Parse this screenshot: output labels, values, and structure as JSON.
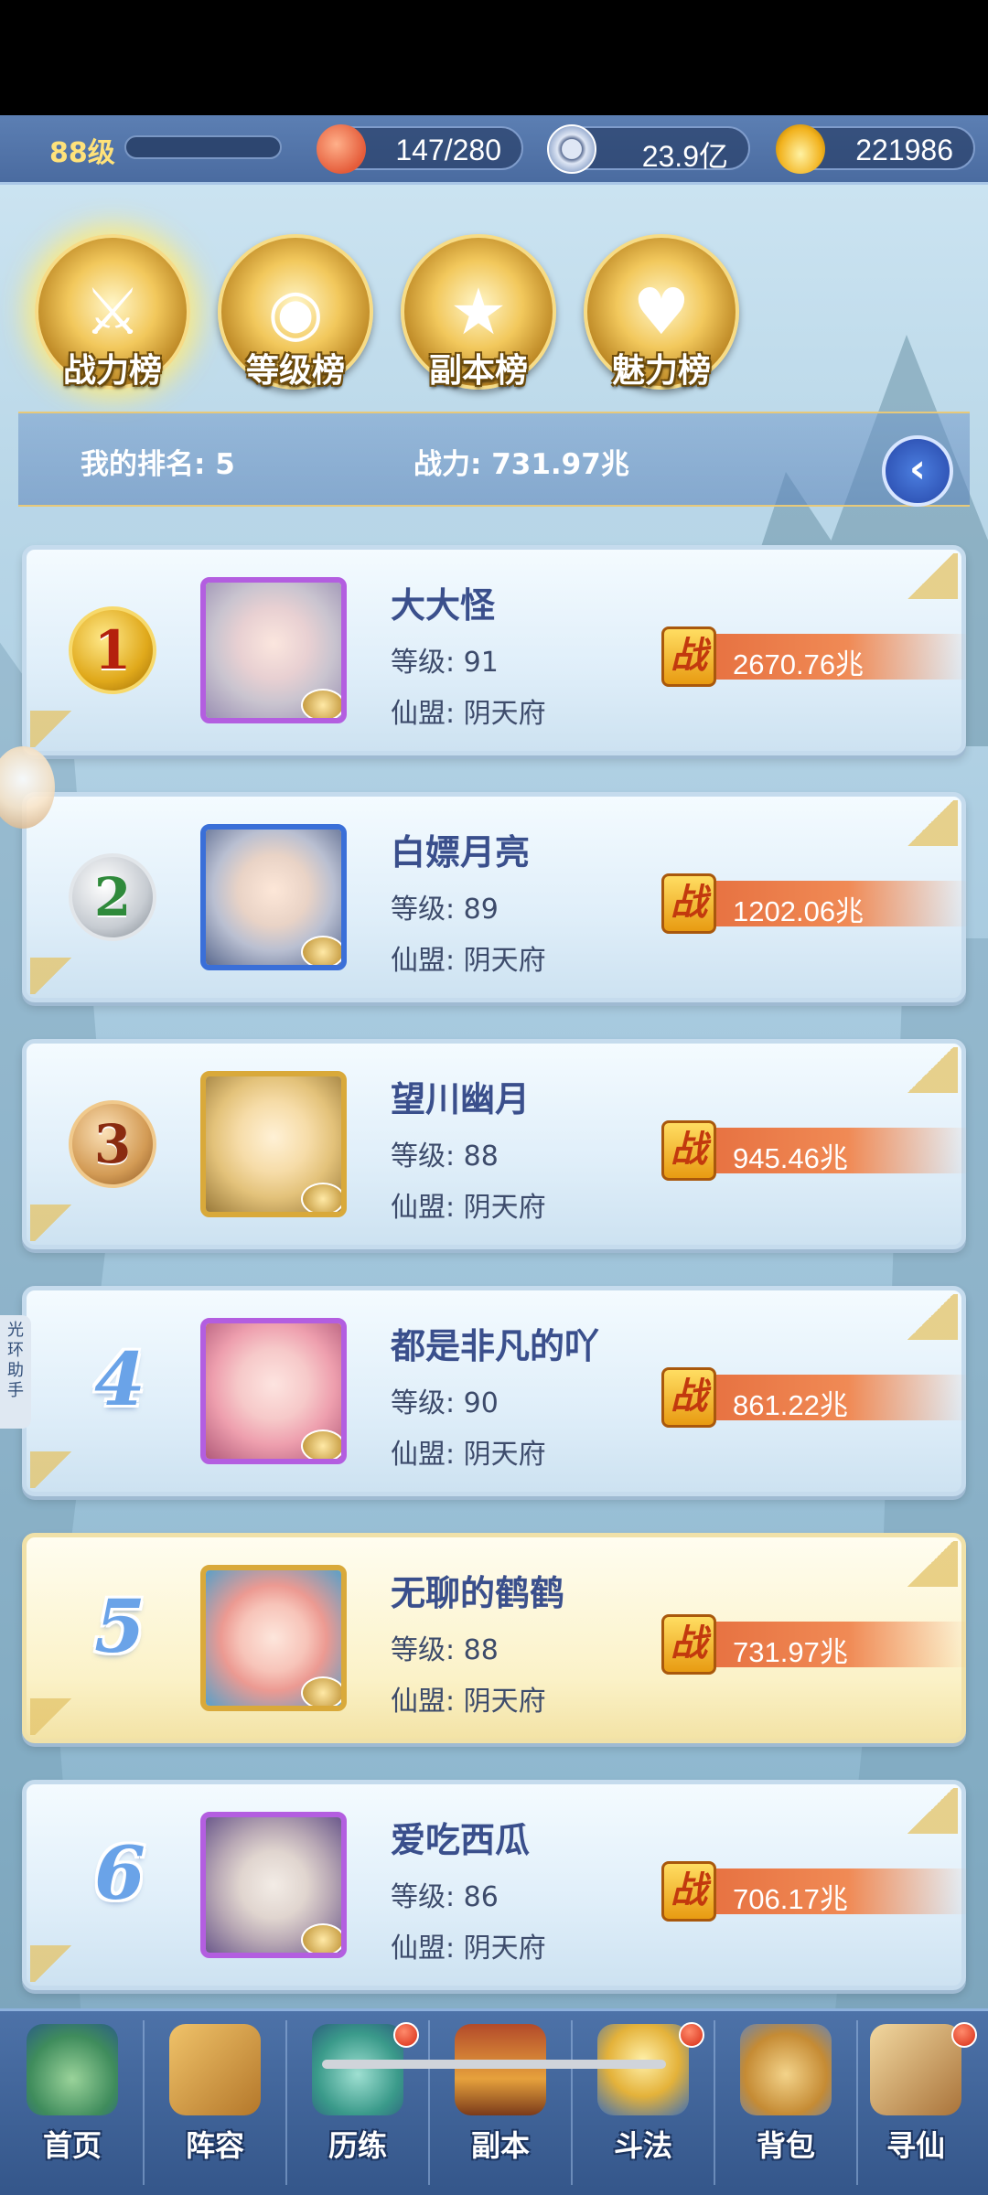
{
  "status": {
    "level": "88级",
    "stamina": "147/280",
    "silver": "23.9亿",
    "gold": "221986",
    "icons": [
      "peach-icon",
      "coin-icon",
      "gold-ingot-icon"
    ]
  },
  "tabs": [
    {
      "label": "战力榜",
      "icon": "sword-emblem-icon",
      "active": true
    },
    {
      "label": "等级榜",
      "icon": "drum-emblem-icon",
      "active": false
    },
    {
      "label": "副本榜",
      "icon": "star-emblem-icon",
      "active": false
    },
    {
      "label": "魅力榜",
      "icon": "heart-emblem-icon",
      "active": false
    }
  ],
  "my_rank": {
    "rank_text": "我的排名: 5",
    "power_text": "战力: 731.97兆"
  },
  "power_badge": "战",
  "rankings": [
    {
      "rank": "1",
      "name": "大大怪",
      "level": "等级: 91",
      "guild": "仙盟: 阴天府",
      "power": "2670.76兆"
    },
    {
      "rank": "2",
      "name": "白嫖月亮",
      "level": "等级: 89",
      "guild": "仙盟: 阴天府",
      "power": "1202.06兆"
    },
    {
      "rank": "3",
      "name": "望川幽月",
      "level": "等级: 88",
      "guild": "仙盟: 阴天府",
      "power": "945.46兆"
    },
    {
      "rank": "4",
      "name": "都是非凡的吖",
      "level": "等级: 90",
      "guild": "仙盟: 阴天府",
      "power": "861.22兆"
    },
    {
      "rank": "5",
      "name": "无聊的鹤鹤",
      "level": "等级: 88",
      "guild": "仙盟: 阴天府",
      "power": "731.97兆"
    },
    {
      "rank": "6",
      "name": "爱吃西瓜",
      "level": "等级: 86",
      "guild": "仙盟: 阴天府",
      "power": "706.17兆"
    }
  ],
  "side_helper": "光环助手",
  "nav": [
    {
      "label": "首页",
      "icon": "home-icon",
      "dot": false
    },
    {
      "label": "阵容",
      "icon": "cards-icon",
      "dot": false
    },
    {
      "label": "历练",
      "icon": "gourd-icon",
      "dot": true
    },
    {
      "label": "副本",
      "icon": "gate-icon",
      "dot": false
    },
    {
      "label": "斗法",
      "icon": "battle-icon",
      "dot": true
    },
    {
      "label": "背包",
      "icon": "bag-icon",
      "dot": false
    },
    {
      "label": "寻仙",
      "icon": "scroll-icon",
      "dot": true
    }
  ]
}
